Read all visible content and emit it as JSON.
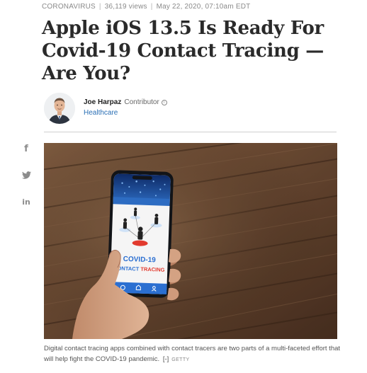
{
  "meta": {
    "category": "CORONAVIRUS",
    "views": "36,119 views",
    "date": "May 22, 2020, 07:10am EDT"
  },
  "headline": "Apple iOS 13.5 Is Ready For Covid-19 Contact Tracing —Are You?",
  "author": {
    "name": "Joe Harpaz",
    "role": "Contributor",
    "section": "Healthcare"
  },
  "social": {
    "icons": [
      "facebook-icon",
      "twitter-icon",
      "linkedin-icon"
    ],
    "facebook_glyph": "f",
    "linkedin_glyph": "in"
  },
  "hero": {
    "phone_line1": "COVID-19",
    "phone_line2_a": "CONTACT ",
    "phone_line2_b": "TRACING"
  },
  "caption": {
    "text": "Digital contact tracing apps combined with contact tracers are two parts of a multi-faceted effort that will help fight the COVID-19 pandemic.",
    "expand": "[-]",
    "credit": "GETTY"
  },
  "colors": {
    "link": "#2a6fb5",
    "covid_blue": "#2b6fd1",
    "covid_red": "#e23a2e",
    "wood": "#6b4a33"
  }
}
